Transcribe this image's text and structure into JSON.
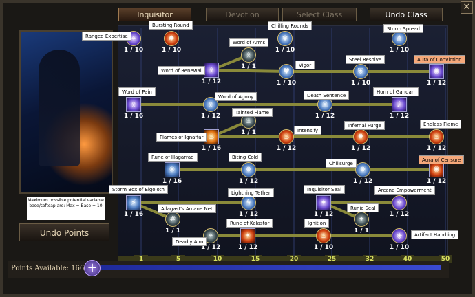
{
  "tabs": {
    "inquisitor": "Inquisitor",
    "devotion": "Devotion",
    "select_class": "Select Class",
    "undo_class": "Undo Class"
  },
  "close_label": "✕",
  "info_note": "Maximum possible potential variable base/softcap are: Max = Base + 10",
  "undo_points": "Undo Points",
  "points_available": "Points Available: 166",
  "plus_label": "+",
  "tier_ticks": [
    "1",
    "5",
    "10",
    "15",
    "20",
    "25",
    "32",
    "40",
    "50"
  ],
  "skills": [
    {
      "id": "ranged-expertise",
      "name": "Ranged Expertise",
      "level": "1 / 10",
      "style": "arcane",
      "shape": "circle",
      "icon": "crosshair-icon"
    },
    {
      "id": "bursting-round",
      "name": "Bursting Round",
      "level": "1 / 10",
      "style": "fire",
      "shape": "circle",
      "icon": "explosion-icon"
    },
    {
      "id": "chilling-rounds",
      "name": "Chilling Rounds",
      "level": "1 / 10",
      "style": "ice",
      "shape": "circle",
      "icon": "frost-bullet-icon"
    },
    {
      "id": "storm-spread",
      "name": "Storm Spread",
      "level": "1 / 10",
      "style": "ice",
      "shape": "circle",
      "icon": "spread-shot-icon"
    },
    {
      "id": "word-of-arms",
      "name": "Word of Arms",
      "level": "1 / 1",
      "style": "dark",
      "shape": "circle",
      "icon": "rune-icon"
    },
    {
      "id": "word-of-renewal",
      "name": "Word of Renewal",
      "level": "1 / 12",
      "style": "arcane",
      "shape": "square",
      "icon": "rune-icon"
    },
    {
      "id": "vigor",
      "name": "Vigor",
      "level": "1 / 10",
      "style": "ice",
      "shape": "circle",
      "icon": "heart-icon"
    },
    {
      "id": "steel-resolve",
      "name": "Steel Resolve",
      "level": "1 / 10",
      "style": "ice",
      "shape": "circle",
      "icon": "shield-icon"
    },
    {
      "id": "aura-of-conviction",
      "name": "Aura of Conviction",
      "level": "1 / 12",
      "style": "arcane",
      "shape": "square",
      "icon": "aura-icon"
    },
    {
      "id": "word-of-pain",
      "name": "Word of Pain",
      "level": "1 / 16",
      "style": "arcane",
      "shape": "square",
      "icon": "rune-icon"
    },
    {
      "id": "word-of-agony",
      "name": "Word of Agony",
      "level": "1 / 12",
      "style": "ice",
      "shape": "circle",
      "icon": "rune-icon"
    },
    {
      "id": "death-sentence",
      "name": "Death Sentence",
      "level": "1 / 12",
      "style": "ice",
      "shape": "circle",
      "icon": "skull-icon"
    },
    {
      "id": "horn-of-gandarr",
      "name": "Horn of Gandarr",
      "level": "1 / 12",
      "style": "arcane",
      "shape": "square",
      "icon": "horn-icon"
    },
    {
      "id": "tainted-flame",
      "name": "Tainted Flame",
      "level": "1 / 1",
      "style": "dark",
      "shape": "circle",
      "icon": "flame-icon"
    },
    {
      "id": "flames-of-ignaffar",
      "name": "Flames of Ignaffar",
      "level": "1 / 16",
      "style": "flame",
      "shape": "square",
      "icon": "flame-icon"
    },
    {
      "id": "intensify",
      "name": "Intensify",
      "level": "1 / 12",
      "style": "fire",
      "shape": "circle",
      "icon": "flame-icon"
    },
    {
      "id": "infernal-purge",
      "name": "Infernal Purge",
      "level": "1 / 12",
      "style": "fire",
      "shape": "circle",
      "icon": "burst-icon"
    },
    {
      "id": "endless-flame",
      "name": "Endless Flame",
      "level": "1 / 12",
      "style": "fire",
      "shape": "circle",
      "icon": "flame-icon"
    },
    {
      "id": "rune-of-hagarrad",
      "name": "Rune of Hagarrad",
      "level": "1 / 16",
      "style": "ice",
      "shape": "square",
      "icon": "frost-rune-icon"
    },
    {
      "id": "biting-cold",
      "name": "Biting Cold",
      "level": "1 / 12",
      "style": "ice",
      "shape": "circle",
      "icon": "frost-icon"
    },
    {
      "id": "chillsurge",
      "name": "Chillsurge",
      "level": "1 / 12",
      "style": "ice",
      "shape": "circle",
      "icon": "frost-icon"
    },
    {
      "id": "aura-of-censure",
      "name": "Aura of Censure",
      "level": "1 / 12",
      "style": "fire",
      "shape": "square",
      "icon": "aura-icon"
    },
    {
      "id": "storm-box-of-elgoloth",
      "name": "Storm Box of Elgoloth",
      "level": "1 / 16",
      "style": "ice",
      "shape": "square",
      "icon": "storm-box-icon"
    },
    {
      "id": "lightning-tether",
      "name": "Lightning Tether",
      "level": "1 / 12",
      "style": "ice",
      "shape": "circle",
      "icon": "lightning-icon"
    },
    {
      "id": "inquisitor-seal",
      "name": "Inquisitor Seal",
      "level": "1 / 12",
      "style": "arcane",
      "shape": "square",
      "icon": "seal-icon"
    },
    {
      "id": "arcane-empowerment",
      "name": "Arcane Empowerment",
      "level": "1 / 12",
      "style": "arcane",
      "shape": "circle",
      "icon": "arcane-icon"
    },
    {
      "id": "allagasts-arcane-net",
      "name": "Allagast's Arcane Net",
      "level": "1 / 1",
      "style": "dark",
      "shape": "circle",
      "icon": "net-icon"
    },
    {
      "id": "runic-seal",
      "name": "Runic Seal",
      "level": "1 / 1",
      "style": "dark",
      "shape": "circle",
      "icon": "seal-icon"
    },
    {
      "id": "deadly-aim",
      "name": "Deadly Aim",
      "level": "1 / 12",
      "style": "dark",
      "shape": "circle",
      "icon": "crosshair-icon"
    },
    {
      "id": "rune-of-kalastor",
      "name": "Rune of Kalastor",
      "level": "1 / 12",
      "style": "fire",
      "shape": "square",
      "icon": "fire-rune-icon"
    },
    {
      "id": "ignition",
      "name": "Ignition",
      "level": "1 / 10",
      "style": "fire",
      "shape": "circle",
      "icon": "flame-icon"
    },
    {
      "id": "artifact-handling",
      "name": "Artifact Handling",
      "level": "1 / 10",
      "style": "arcane",
      "shape": "circle",
      "icon": "artifact-icon"
    }
  ],
  "colors": {
    "link": "#8a8a3a",
    "accent_orange": "#f5a87a",
    "points_blue": "#3a4ad0"
  }
}
